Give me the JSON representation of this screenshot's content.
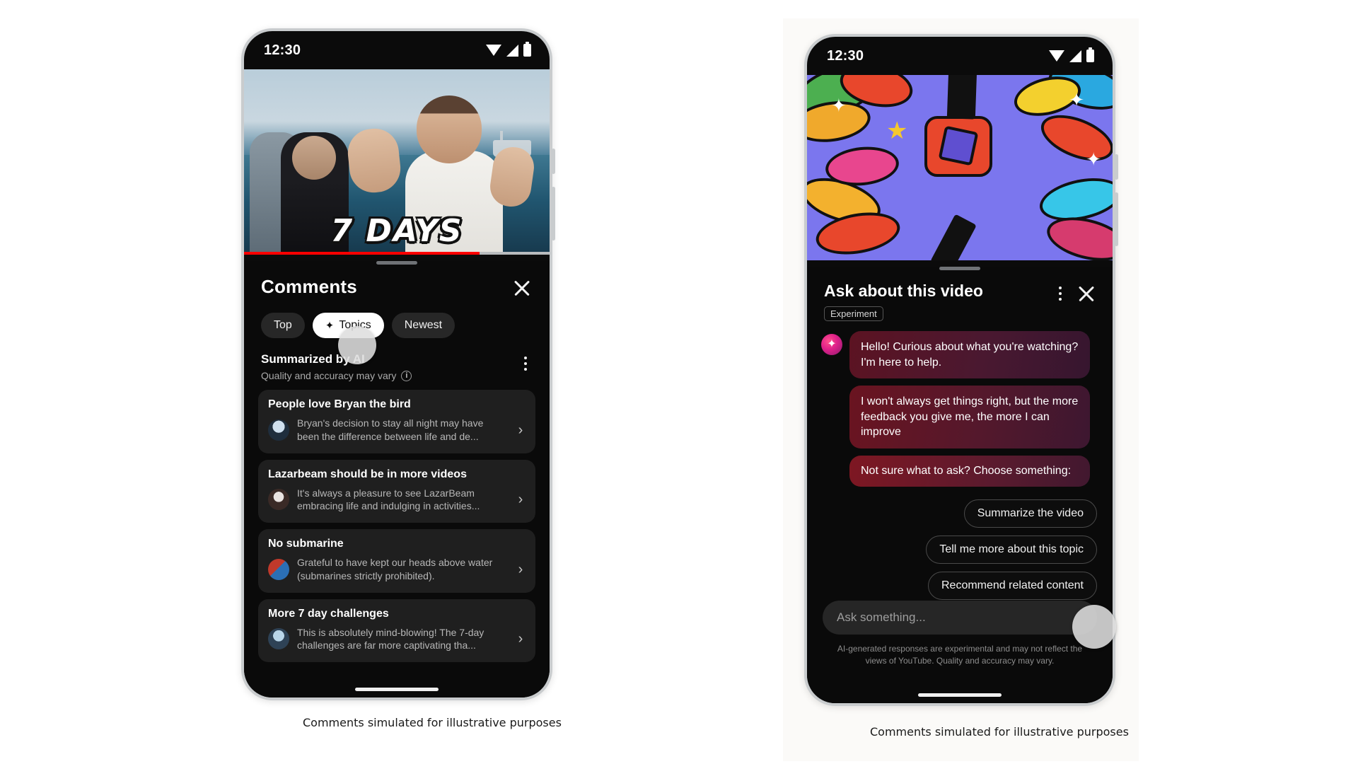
{
  "left_phone": {
    "status_bar": {
      "time": "12:30",
      "icons": [
        "wifi-icon",
        "cell-signal-icon",
        "battery-icon"
      ]
    },
    "video": {
      "overlay_title": "7 DAYS",
      "progress_percent": 77
    },
    "sheet": {
      "title": "Comments",
      "close_icon": "close-icon",
      "filter_chips": [
        {
          "label": "Top",
          "active": false,
          "icon": null
        },
        {
          "label": "Topics",
          "active": true,
          "icon": "sparkle-icon",
          "icon_glyph": "✦"
        },
        {
          "label": "Newest",
          "active": false,
          "icon": null
        }
      ],
      "summary_header": {
        "title": "Summarized by AI",
        "subtitle": "Quality and accuracy may vary",
        "info_icon": "info-icon",
        "overflow_icon": "kebab-menu-icon"
      },
      "topic_cards": [
        {
          "title": "People love Bryan the bird",
          "snippet": "Bryan's decision to stay all night may have been the difference between life and de...",
          "chevron": "chevron-right-icon"
        },
        {
          "title": "Lazarbeam should be in more videos",
          "snippet": "It's always a pleasure to see LazarBeam embracing life and indulging in activities...",
          "chevron": "chevron-right-icon"
        },
        {
          "title": "No submarine",
          "snippet": "Grateful to have kept our heads above water (submarines strictly prohibited).",
          "chevron": "chevron-right-icon"
        },
        {
          "title": "More 7 day challenges",
          "snippet": "This is absolutely mind-blowing! The 7-day challenges are far more captivating tha...",
          "chevron": "chevron-right-icon"
        }
      ]
    },
    "caption": "Comments simulated for illustrative purposes"
  },
  "right_phone": {
    "status_bar": {
      "time": "12:30",
      "icons": [
        "wifi-icon",
        "cell-signal-icon",
        "battery-icon"
      ]
    },
    "sheet": {
      "title": "Ask about this video",
      "badge": "Experiment",
      "overflow_icon": "kebab-menu-icon",
      "close_icon": "close-icon",
      "messages": [
        {
          "sender": "ai",
          "avatar_icon": "ai-sparkle-icon",
          "avatar_glyph": "✦",
          "text": "Hello! Curious about what you're watching? I'm here to help."
        },
        {
          "sender": "ai",
          "text": "I won't always get things right, but the more feedback you give me, the more I can improve"
        },
        {
          "sender": "ai",
          "text": "Not sure what to ask? Choose something:"
        }
      ],
      "suggestions": [
        "Summarize the video",
        "Tell me more about this topic",
        "Recommend related content"
      ],
      "composer": {
        "placeholder": "Ask something...",
        "value": ""
      },
      "disclaimer": "AI-generated responses are experimental and may not reflect the views of YouTube. Quality and accuracy may vary."
    },
    "caption": "Comments simulated for illustrative purposes"
  },
  "colors": {
    "accent_red": "#ff0000",
    "sheet_background": "#0a0a0a",
    "card_background": "#1f1f1f",
    "chip_inactive": "#272727",
    "chip_active": "#ffffff",
    "ai_bubble_start": "#7e1722",
    "ai_bubble_end": "#36162f",
    "page_background": "#ffffff"
  }
}
